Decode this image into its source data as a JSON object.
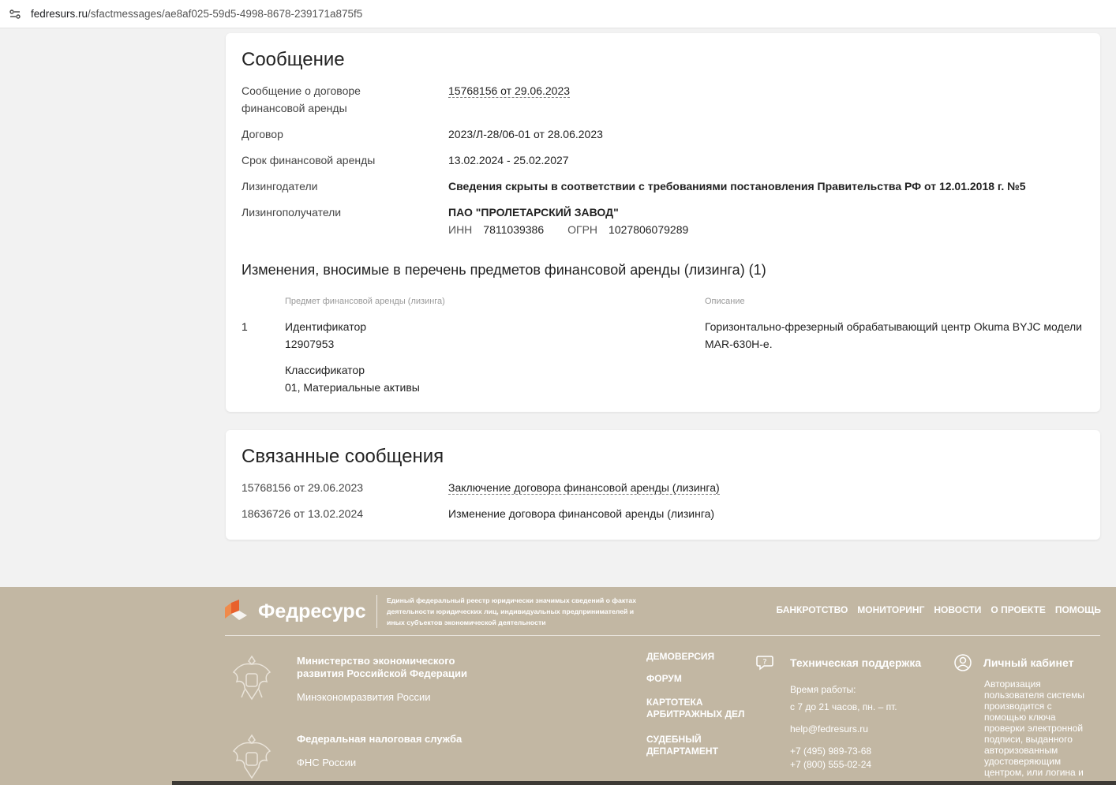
{
  "browser": {
    "url_host": "fedresurs.ru",
    "url_path": "/sfactmessages/ae8af025-59d5-4998-8678-239171a875f5"
  },
  "message": {
    "title": "Сообщение",
    "fields": [
      {
        "label": "Сообщение о договоре финансовой аренды",
        "value": "15768156 от 29.06.2023"
      },
      {
        "label": "Договор",
        "value": "2023/Л-28/06-01 от 28.06.2023"
      },
      {
        "label": "Срок финансовой аренды",
        "value": "13.02.2024 - 25.02.2027"
      },
      {
        "label": "Лизингодатели",
        "value": "Сведения скрыты в соответствии с требованиями постановления Правительства РФ от 12.01.2018 г. №5"
      },
      {
        "label": "Лизингополучатели",
        "value": "ПАО \"ПРОЛЕТАРСКИЙ ЗАВОД\""
      }
    ],
    "lessee_ids": {
      "inn_label": "ИНН",
      "inn": "7811039386",
      "ogrn_label": "ОГРН",
      "ogrn": "1027806079289"
    },
    "changes_title": "Изменения, вносимые в перечень предметов финансовой аренды (лизинга) (1)",
    "table": {
      "col_subject": "Предмет финансовой аренды (лизинга)",
      "col_description": "Описание",
      "rows": [
        {
          "num": "1",
          "id_label": "Идентификатор",
          "id_value": "12907953",
          "class_label": "Классификатор",
          "class_value": "01, Материальные активы",
          "description_1": "Горизонтально-фрезерный обрабатывающий центр Okuma BYJC модели",
          "description_2": "MAR-630H-e."
        }
      ]
    }
  },
  "related": {
    "title": "Связанные сообщения",
    "items": [
      {
        "ref": "15768156 от 29.06.2023",
        "title": "Заключение договора финансовой аренды (лизинга)"
      },
      {
        "ref": "18636726 от 13.02.2024",
        "title": "Изменение договора финансовой аренды (лизинга)"
      }
    ]
  },
  "footer": {
    "brand": "Федресурс",
    "tagline": "Единый федеральный реестр юридически значимых сведений о фактах деятельности юридических лиц, индивидуальных предпринимателей и иных субъектов экономической деятельности",
    "nav": [
      "БАНКРОТСТВО",
      "МОНИТОРИНГ",
      "НОВОСТИ",
      "О ПРОЕКТЕ",
      "ПОМОЩЬ"
    ],
    "org1_line1": "Министерство экономического",
    "org1_line2": "развития Российской Федерации",
    "org1_short": "Минэкономразвития России",
    "org2_name": "Федеральная налоговая служба",
    "org2_short": "ФНС России",
    "mid_links": [
      "ДЕМОВЕРСИЯ",
      "ФОРУМ",
      "КАРТОТЕКА",
      "АРБИТРАЖНЫХ ДЕЛ",
      "СУДЕБНЫЙ",
      "ДЕПАРТАМЕНТ"
    ],
    "support_title": "Техническая поддержка",
    "support_hours_label": "Время работы:",
    "support_hours": "с 7 до 21 часов, пн. – пт.",
    "support_email": "help@fedresurs.ru",
    "support_phone1": "+7 (495) 989-73-68",
    "support_phone2": "+7 (800) 555-02-24",
    "cabinet_title": "Личный кабинет",
    "cabinet_text": "Авторизация пользователя системы производится с помощью ключа проверки электронной подписи, выданного авторизованным удостоверяющим центром, или логина и",
    "colors": {
      "footer_bg": "#c2b7a3",
      "logo_orange": "#e8612c"
    }
  }
}
